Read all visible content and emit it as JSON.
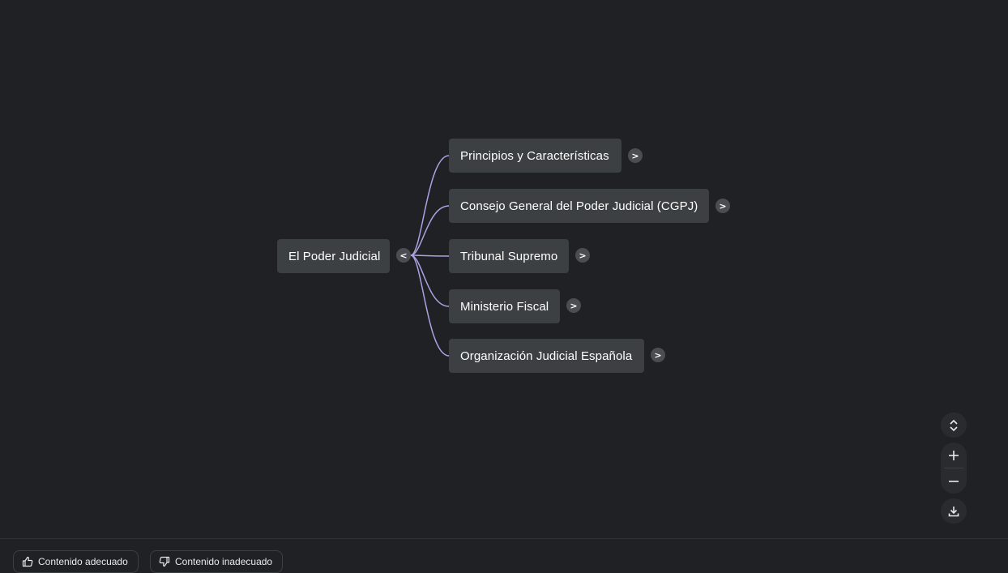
{
  "mindmap": {
    "root": {
      "label": "El Poder Judicial",
      "toggle": "<"
    },
    "children": [
      {
        "label": "Principios y Características",
        "toggle": ">"
      },
      {
        "label": "Consejo General del Poder Judicial (CGPJ)",
        "toggle": ">"
      },
      {
        "label": "Tribunal Supremo",
        "toggle": ">"
      },
      {
        "label": "Ministerio Fiscal",
        "toggle": ">"
      },
      {
        "label": "Organización Judicial Española",
        "toggle": ">"
      }
    ],
    "link_color": "#a8a4e6"
  },
  "controls": {
    "icons": [
      "expand-collapse-icon",
      "zoom-in-icon",
      "zoom-out-icon",
      "download-icon"
    ]
  },
  "footer": {
    "good_label": "Contenido adecuado",
    "bad_label": "Contenido inadecuado"
  }
}
